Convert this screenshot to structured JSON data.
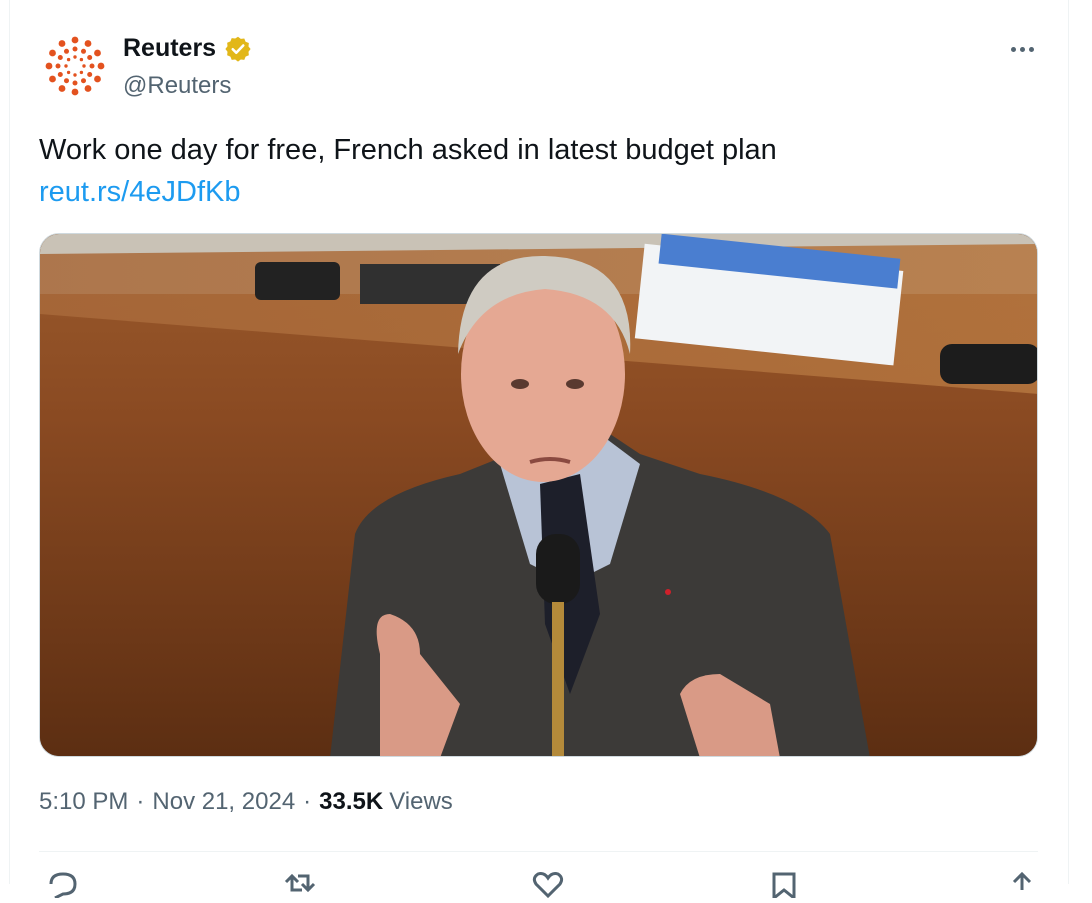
{
  "author": {
    "name": "Reuters",
    "handle": "@Reuters",
    "verified_icon": "gold-verified-badge",
    "brand_color": "#e3521f"
  },
  "tweet": {
    "text": "Work one day for free, French asked in latest budget plan",
    "link": "reut.rs/4eJDfKb",
    "link_color": "#1d9bf0"
  },
  "meta": {
    "time": "5:10 PM",
    "date": "Nov 21, 2024",
    "views_count": "33.5K",
    "views_label": "Views",
    "separator": "·"
  },
  "actions": [
    "reply-icon",
    "retweet-icon",
    "like-icon",
    "bookmark-icon",
    "share-icon"
  ]
}
